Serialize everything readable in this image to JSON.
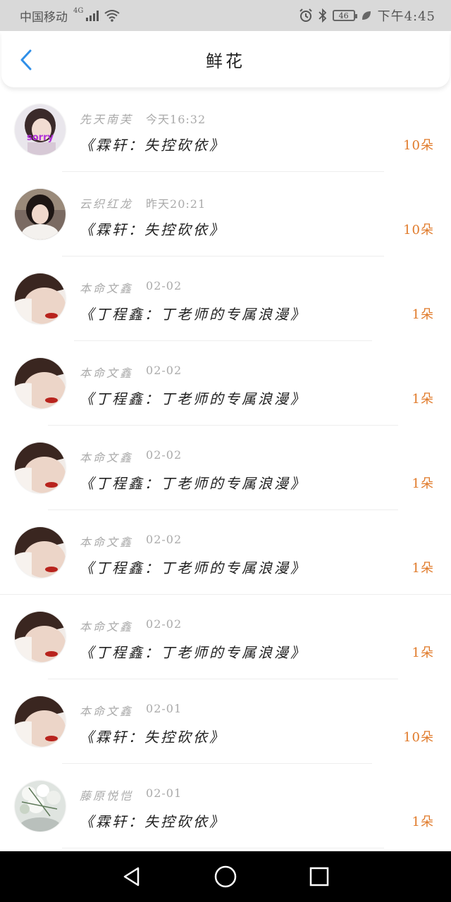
{
  "status_bar": {
    "carrier": "中国移动",
    "network": "4G",
    "battery": "46",
    "time": "下午4:45",
    "icons": [
      "signal-icon",
      "wifi-icon",
      "alarm-icon",
      "bluetooth-icon",
      "battery-icon",
      "leaf-icon"
    ]
  },
  "header": {
    "title": "鲜花",
    "back_icon": "chevron-left-icon"
  },
  "colors": {
    "accent": "#2f8fe8",
    "count": "#e07a2a",
    "meta": "#aaaaaa"
  },
  "items": [
    {
      "name": "先天南芙",
      "time": "今天16:32",
      "book": "《霖轩：失控砍依》",
      "count": "10朵",
      "avatar": "avatar-sorry"
    },
    {
      "name": "云织红龙",
      "time": "昨天20:21",
      "book": "《霖轩：失控砍依》",
      "count": "10朵",
      "avatar": "avatar-girl"
    },
    {
      "name": "本命文鑫",
      "time": "02-02",
      "book": "《丁程鑫：丁老师的专属浪漫》",
      "count": "1朵",
      "avatar": "avatar-face"
    },
    {
      "name": "本命文鑫",
      "time": "02-02",
      "book": "《丁程鑫：丁老师的专属浪漫》",
      "count": "1朵",
      "avatar": "avatar-face"
    },
    {
      "name": "本命文鑫",
      "time": "02-02",
      "book": "《丁程鑫：丁老师的专属浪漫》",
      "count": "1朵",
      "avatar": "avatar-face"
    },
    {
      "name": "本命文鑫",
      "time": "02-02",
      "book": "《丁程鑫：丁老师的专属浪漫》",
      "count": "1朵",
      "avatar": "avatar-face"
    },
    {
      "name": "本命文鑫",
      "time": "02-02",
      "book": "《丁程鑫：丁老师的专属浪漫》",
      "count": "1朵",
      "avatar": "avatar-face"
    },
    {
      "name": "本命文鑫",
      "time": "02-01",
      "book": "《霖轩：失控砍依》",
      "count": "10朵",
      "avatar": "avatar-face"
    },
    {
      "name": "藤原悦恺",
      "time": "02-01",
      "book": "《霖轩：失控砍依》",
      "count": "1朵",
      "avatar": "avatar-flowers"
    }
  ],
  "avatar_badge_text": "sorry",
  "nav": [
    "back-triangle-icon",
    "home-circle-icon",
    "recents-square-icon"
  ]
}
